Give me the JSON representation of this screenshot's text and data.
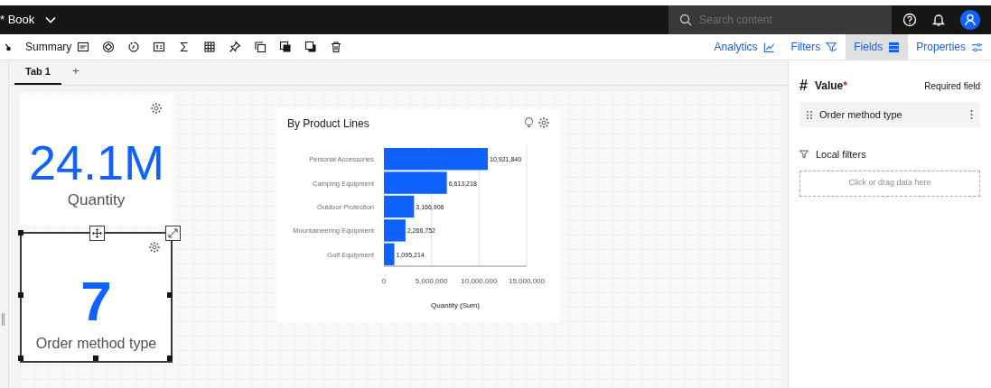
{
  "header": {
    "title": "* Book",
    "search": {
      "placeholder": "Search content"
    }
  },
  "toolbar": {
    "label": "Summary",
    "panel_tabs": [
      {
        "label": "Analytics",
        "kind": "analytics",
        "selected": false
      },
      {
        "label": "Filters",
        "kind": "filters",
        "selected": false
      },
      {
        "label": "Fields",
        "kind": "fields",
        "selected": true
      },
      {
        "label": "Properties",
        "kind": "properties",
        "selected": false
      }
    ]
  },
  "tabs": [
    {
      "label": "Tab 1",
      "selected": true
    }
  ],
  "add_tab": "+",
  "tiles": [
    {
      "kind": "kpi",
      "value": "24.1M",
      "label": "Quantity",
      "selected": false
    },
    {
      "kind": "kpi",
      "value": "7",
      "label": "Order method type",
      "selected": true
    },
    {
      "kind": "chart",
      "title": "By Product Lines",
      "chart_data": {
        "type": "bar",
        "orientation": "horizontal",
        "xlabel": "Quantity (Sum)",
        "categories": [
          "Personal Accessories",
          "Camping Equipment",
          "Outdoor Protection",
          "Mountaineering Equipment",
          "Golf Equipment"
        ],
        "series": [
          {
            "color": "#0f62fe",
            "values": [
              10921840,
              6613218,
              3166906,
              2266752,
              1095214
            ]
          }
        ],
        "value_labels": [
          "10,921,840",
          "6,613,218",
          "3,166,906",
          "2,266,752",
          "1,095,214"
        ],
        "xlim": [
          0,
          15000000
        ],
        "xticks": [
          {
            "value": 0,
            "label": "0"
          },
          {
            "value": 5000000,
            "label": "5,000,000"
          },
          {
            "value": 10000000,
            "label": "10,000,000"
          },
          {
            "value": 15000000,
            "label": "15,000,000"
          }
        ]
      }
    }
  ],
  "panel": {
    "value_icon": "#",
    "value_heading": "Value",
    "required_mark": "*",
    "required_note": "Required field",
    "value_field": "Order method type",
    "filters_heading": "Local filters",
    "drop_hint": "Click or drag data here"
  }
}
